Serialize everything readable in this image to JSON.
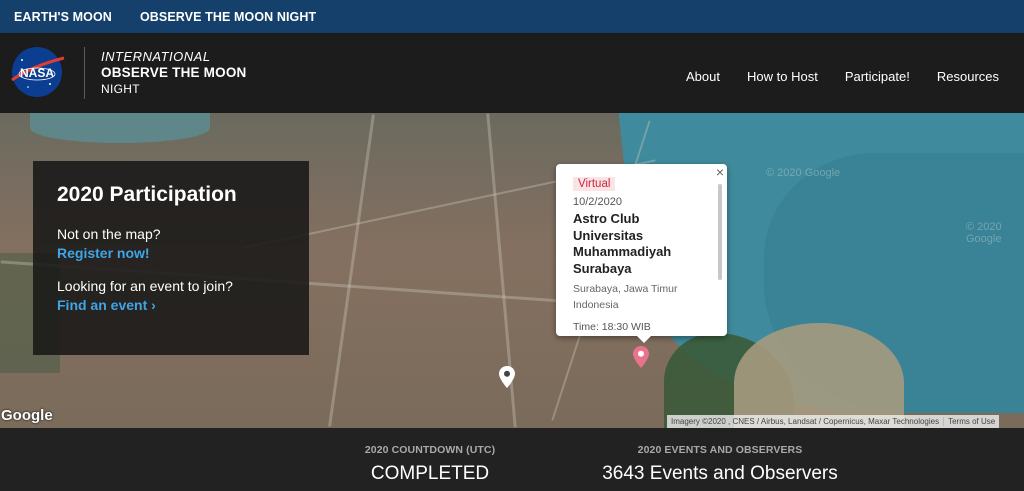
{
  "topbar": {
    "links": [
      "EARTH'S MOON",
      "OBSERVE THE MOON NIGHT"
    ]
  },
  "header": {
    "logo_text": "NASA",
    "title_line1": "INTERNATIONAL",
    "title_line2": "OBSERVE THE MOON",
    "title_line3": "NIGHT",
    "nav": [
      "About",
      "How to Host",
      "Participate!",
      "Resources"
    ]
  },
  "participation": {
    "title": "2020 Participation",
    "prompt1": "Not on the map?",
    "link1": "Register now!",
    "prompt2": "Looking for an event to join?",
    "link2": "Find an event ›"
  },
  "popup": {
    "badge": "Virtual",
    "date": "10/2/2020",
    "name": "Astro Club Universitas Muhammadiyah Surabaya",
    "location_line1": "Surabaya, Jawa Timur",
    "location_line2": "Indonesia",
    "time": "Time: 18:30 WIB",
    "close": "×"
  },
  "map": {
    "watermark": "© 2020 Google",
    "google_logo": "Google",
    "attribution": "Imagery ©2020 , CNES / Airbus, Landsat / Copernicus, Maxar Technologies",
    "terms": "Terms of Use",
    "pins": [
      {
        "type": "selected",
        "color": "#e8738a",
        "icon": "map-pin-icon"
      },
      {
        "type": "default",
        "color": "#ffffff",
        "icon": "map-pin-icon"
      }
    ]
  },
  "stats": {
    "countdown_label": "2020 COUNTDOWN (UTC)",
    "countdown_value": "COMPLETED",
    "events_label": "2020 EVENTS AND OBSERVERS",
    "events_value": "3643 Events and Observers"
  },
  "colors": {
    "topbar": "#14406b",
    "header": "#1c1c1c",
    "link": "#3fa5e6",
    "badge_text": "#c82a3d",
    "badge_bg": "#fbe3e6"
  }
}
